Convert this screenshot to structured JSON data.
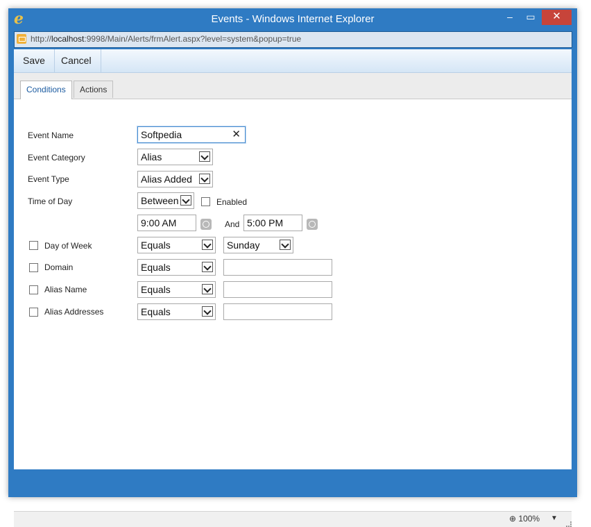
{
  "window": {
    "title": "Events - Windows Internet Explorer",
    "minimize": "‒",
    "maximize": "▭",
    "close": "✕"
  },
  "address": {
    "prefix": "http://",
    "host": "localhost",
    "rest": ":9998/Main/Alerts/frmAlert.aspx?level=system&popup=true"
  },
  "toolbar": {
    "save": "Save",
    "cancel": "Cancel"
  },
  "tabs": [
    {
      "label": "Conditions"
    },
    {
      "label": "Actions"
    }
  ],
  "form": {
    "event_name": {
      "label": "Event Name",
      "value": "Softpedia",
      "clear": "✕"
    },
    "event_category": {
      "label": "Event Category",
      "value": "Alias"
    },
    "event_type": {
      "label": "Event Type",
      "value": "Alias Added"
    },
    "time_of_day": {
      "label": "Time of Day",
      "operator": "Between",
      "enabled_label": "Enabled",
      "start": "9:00 AM",
      "and_label": "And",
      "end": "5:00 PM"
    },
    "day_of_week": {
      "label": "Day of Week",
      "operator": "Equals",
      "value": "Sunday"
    },
    "domain": {
      "label": "Domain",
      "operator": "Equals",
      "value": ""
    },
    "alias_name": {
      "label": "Alias Name",
      "operator": "Equals",
      "value": ""
    },
    "alias_addresses": {
      "label": "Alias Addresses",
      "operator": "Equals",
      "value": ""
    }
  },
  "status": {
    "zoom": "100%",
    "zoom_arrow": "▼"
  }
}
